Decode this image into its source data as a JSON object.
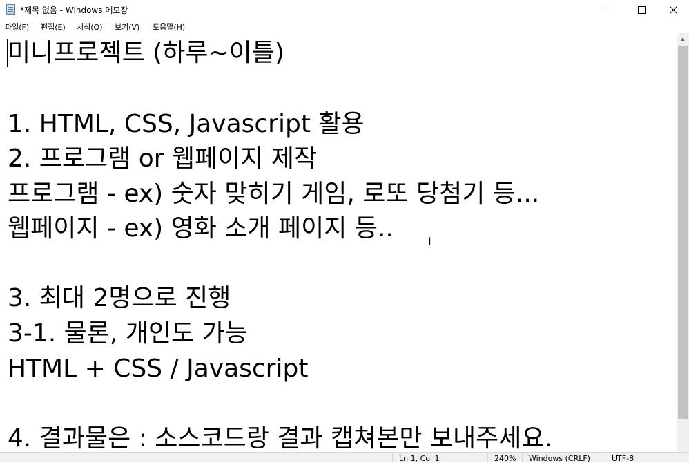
{
  "window": {
    "title": "*제목 없음 - Windows 메모장"
  },
  "menu": [
    "파일(F)",
    "편집(E)",
    "서식(O)",
    "보기(V)",
    "도움말(H)"
  ],
  "document": {
    "lines": [
      "미니프로젝트 (하루~이틀)",
      "",
      "1. HTML, CSS, Javascript 활용",
      "2. 프로그램 or 웹페이지 제작",
      "프로그램 - ex) 숫자 맞히기 게임, 로또 당첨기 등...",
      "웹페이지 - ex) 영화 소개 페이지 등..",
      "",
      "3. 최대 2명으로 진행",
      "3-1. 물론, 개인도 가능",
      "HTML + CSS / Javascript",
      "",
      "4. 결과물은 : 소스코드랑 결과 캡쳐본만 보내주세요."
    ]
  },
  "status": {
    "position": "Ln 1, Col 1",
    "zoom": "240%",
    "line_ending": "Windows (CRLF)",
    "encoding": "UTF-8"
  }
}
